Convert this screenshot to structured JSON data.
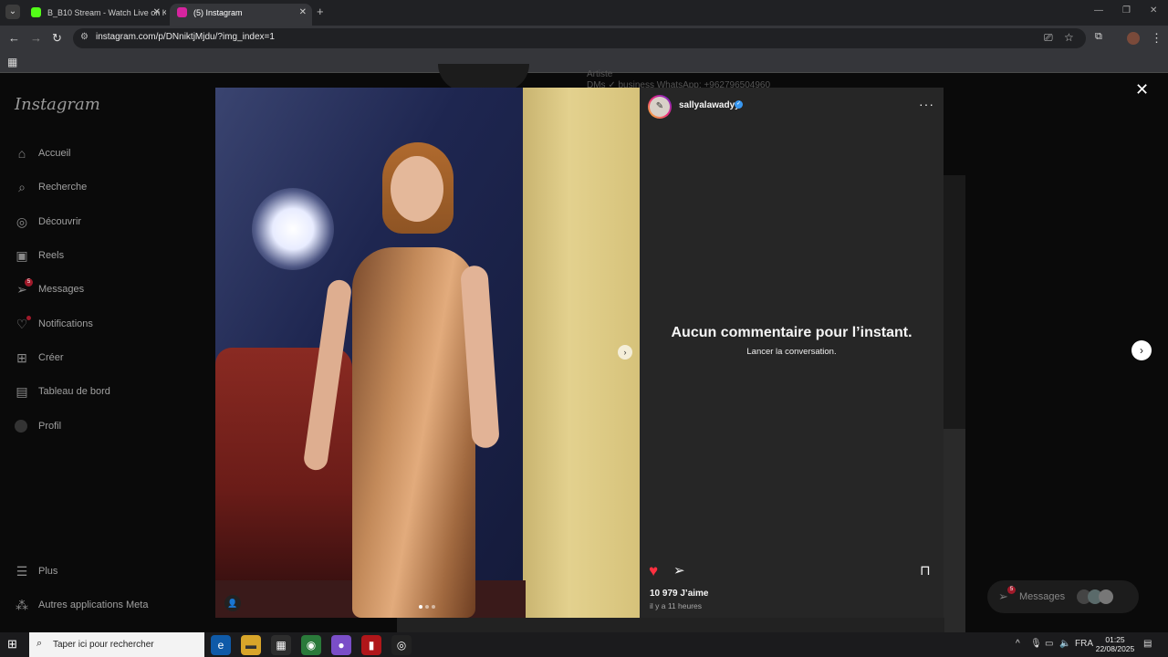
{
  "browser": {
    "tabs": [
      {
        "title": "B_B10 Stream - Watch Live on K",
        "favicon_color": "#53fc18"
      },
      {
        "title": "(5) Instagram",
        "favicon_color": "#d6249f"
      }
    ],
    "address": "instagram.com/p/DNniktjMjdu/?img_index=1"
  },
  "sidebar": {
    "logo": "Instagram",
    "items": [
      {
        "label": "Accueil",
        "icon": "home-icon"
      },
      {
        "label": "Recherche",
        "icon": "search-icon"
      },
      {
        "label": "Découvrir",
        "icon": "compass-icon"
      },
      {
        "label": "Reels",
        "icon": "reels-icon"
      },
      {
        "label": "Messages",
        "icon": "send-icon",
        "badge": "5"
      },
      {
        "label": "Notifications",
        "icon": "heart-icon"
      },
      {
        "label": "Créer",
        "icon": "plus-square-icon"
      },
      {
        "label": "Tableau de bord",
        "icon": "dashboard-icon"
      },
      {
        "label": "Profil",
        "icon": "profile-icon"
      },
      {
        "label": "Plus",
        "icon": "menu-icon"
      },
      {
        "label": "Autres applications Meta",
        "icon": "meta-apps-icon"
      }
    ]
  },
  "background_profile": {
    "line1": "Artiste",
    "line2": "DMs ✓ business WhatsApp: +962796504960"
  },
  "post": {
    "username": "sallyalawadyy",
    "empty_title": "Aucun commentaire pour l’instant.",
    "empty_subtitle": "Lancer la conversation.",
    "likes": "10 979 J’aime",
    "time": "il y a 11 heures",
    "like_color": "#ff3040"
  },
  "floating_messages": {
    "label": "Messages",
    "badge": "5"
  },
  "taskbar": {
    "search_placeholder": "Taper ici pour rechercher",
    "lang": "FRA",
    "time": "01:25",
    "date": "22/08/2025"
  }
}
